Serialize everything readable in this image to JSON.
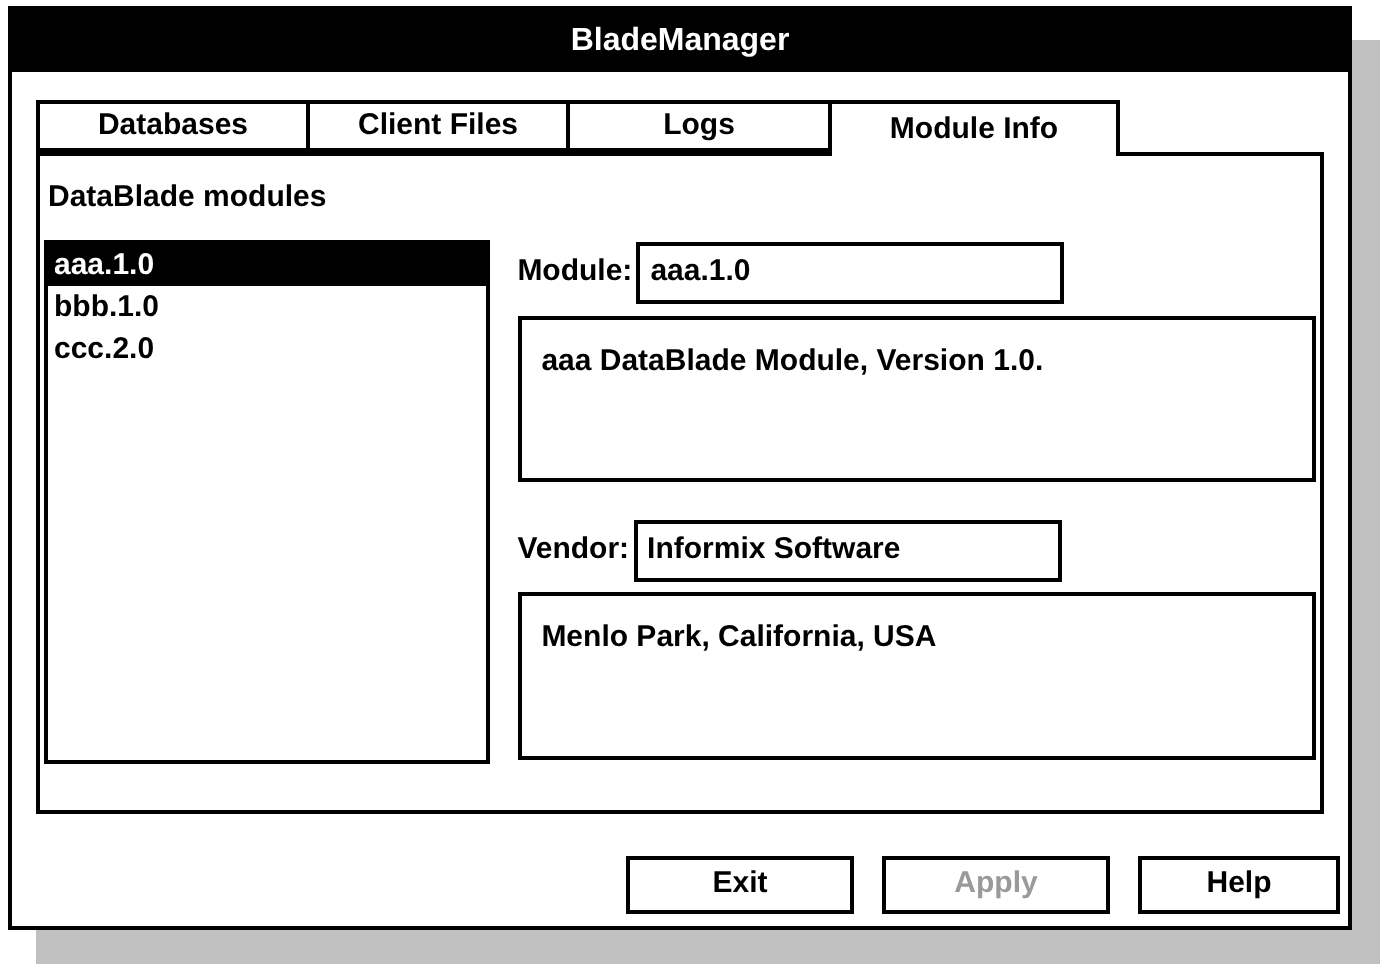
{
  "window": {
    "title": "BladeManager"
  },
  "tabs": [
    {
      "label": "Databases",
      "selected": false
    },
    {
      "label": "Client Files",
      "selected": false
    },
    {
      "label": "Logs",
      "selected": false
    },
    {
      "label": "Module Info",
      "selected": true
    }
  ],
  "modules": {
    "label": "DataBlade modules",
    "items": [
      {
        "label": "aaa.1.0",
        "selected": true
      },
      {
        "label": "bbb.1.0",
        "selected": false
      },
      {
        "label": "ccc.2.0",
        "selected": false
      }
    ]
  },
  "module": {
    "label": "Module:",
    "value": "aaa.1.0",
    "description": "aaa DataBlade Module, Version 1.0."
  },
  "vendor": {
    "label": "Vendor:",
    "value": "Informix Software",
    "address": "Menlo Park, California, USA"
  },
  "buttons": [
    {
      "label": "Exit",
      "disabled": false
    },
    {
      "label": "Apply",
      "disabled": true
    },
    {
      "label": "Help",
      "disabled": false
    }
  ]
}
